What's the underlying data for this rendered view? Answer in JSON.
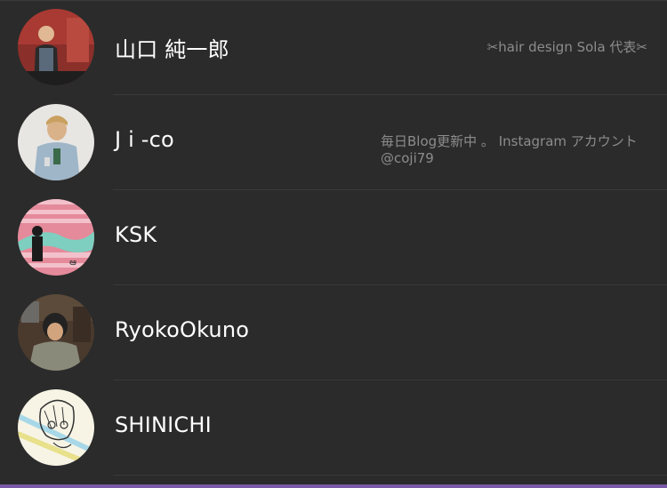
{
  "members": [
    {
      "name": "山口 純一郎",
      "bio": "✂hair design Sola 代表✂"
    },
    {
      "name": "J i -co",
      "bio": "毎日Blog更新中 。 Instagram アカウント @coji79"
    },
    {
      "name": "KSK",
      "bio": ""
    },
    {
      "name": "RyokoOkuno",
      "bio": ""
    },
    {
      "name": "SHINICHI",
      "bio": ""
    }
  ],
  "colors": {
    "background": "#2b2b2b",
    "name_text": "#ffffff",
    "bio_text": "#8c8c8c",
    "divider": "#3a3a3a",
    "accent_bar": "#7a5aa8"
  }
}
